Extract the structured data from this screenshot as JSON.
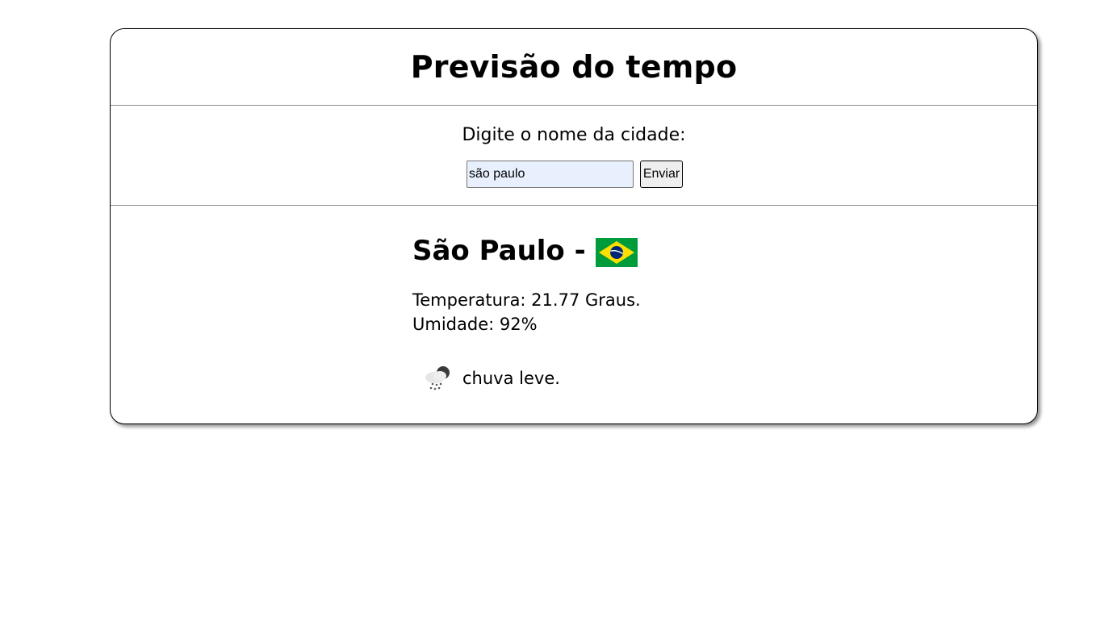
{
  "header": {
    "title": "Previsão do tempo"
  },
  "search": {
    "label": "Digite o nome da cidade:",
    "value": "são paulo",
    "button_label": "Enviar"
  },
  "result": {
    "city": "São Paulo -",
    "country_flag_icon": "brazil-flag-icon",
    "temperature": "Temperatura: 21.77 Graus.",
    "humidity": "Umidade: 92%",
    "weather_icon": "light-rain-icon",
    "description": "chuva leve."
  },
  "colors": {
    "input_background": "#e8f0fe",
    "button_background": "#efefef",
    "flag_green": "#009b3a",
    "flag_yellow": "#fedf00",
    "flag_blue": "#002776"
  }
}
